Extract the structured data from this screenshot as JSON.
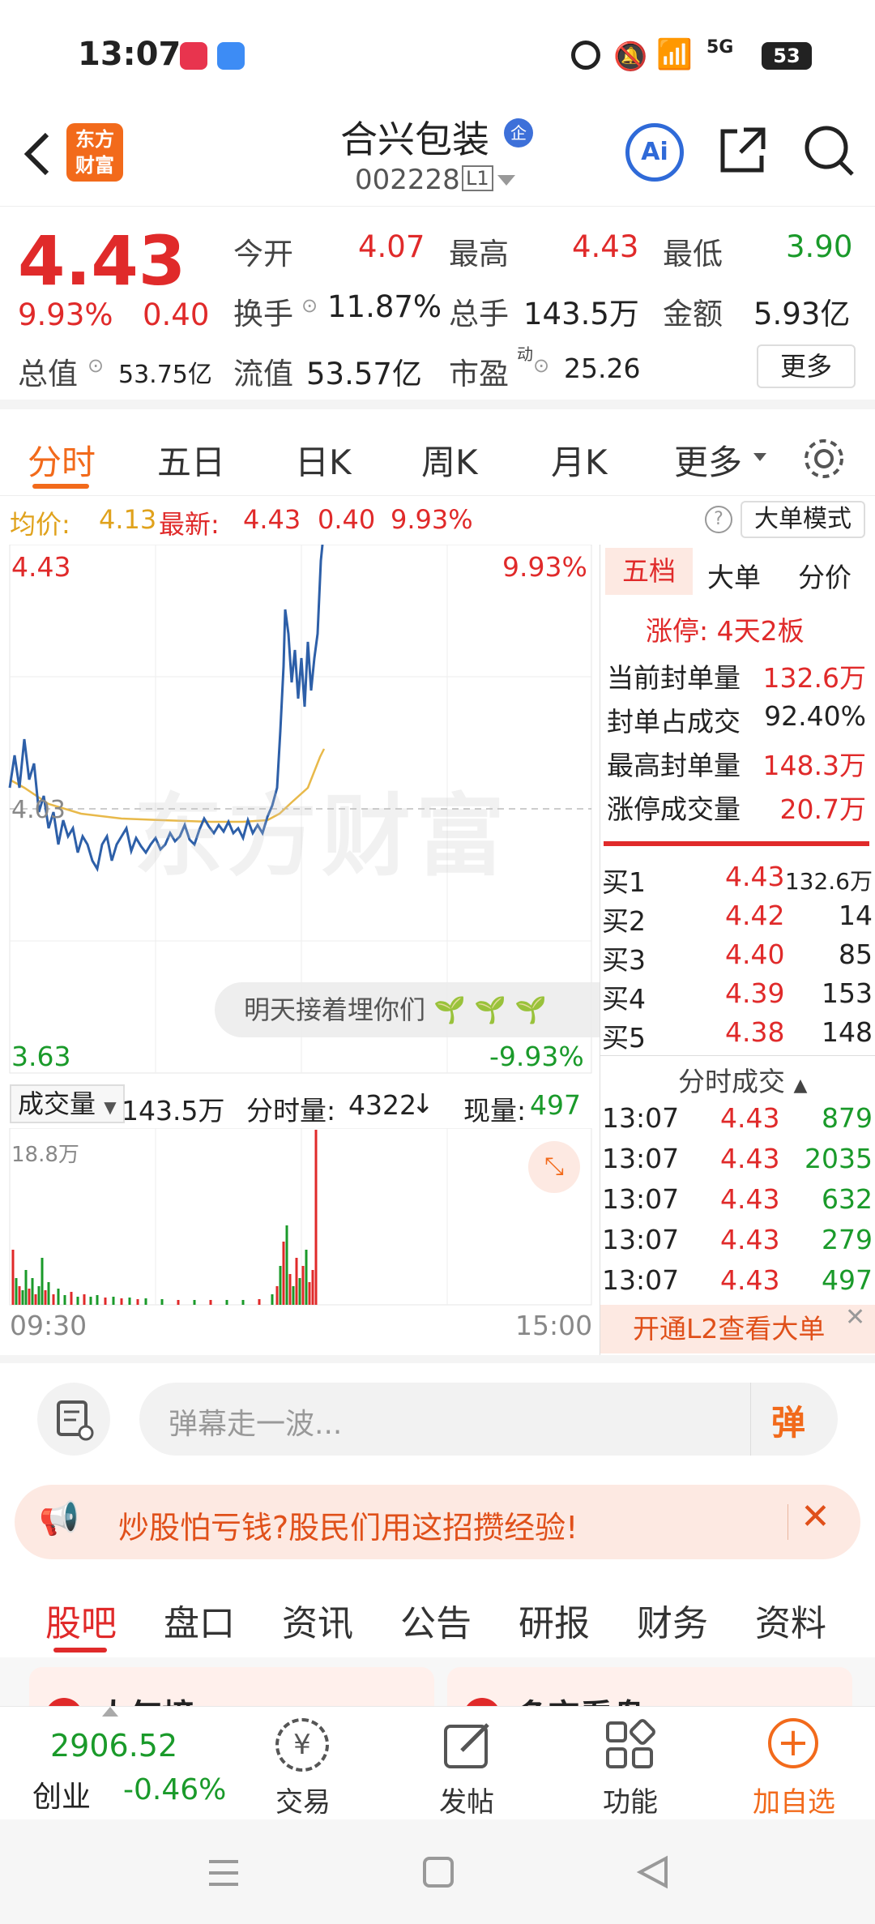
{
  "status_bar": {
    "time": "13:07",
    "network": "5G",
    "battery": "53"
  },
  "header": {
    "stock_name": "合兴包装",
    "stock_code": "002228",
    "level": "L1",
    "logo_line1": "东方",
    "logo_line2": "财富",
    "ai_label": "Ai",
    "enterprise_badge": "企"
  },
  "quote": {
    "price": "4.43",
    "change_pct": "9.93%",
    "change": "0.40",
    "open_label": "今开",
    "open": "4.07",
    "high_label": "最高",
    "high": "4.43",
    "low_label": "最低",
    "low": "3.90",
    "turnover_label": "换手",
    "turnover": "11.87%",
    "volume_label": "总手",
    "volume": "143.5万",
    "amount_label": "金额",
    "amount": "5.93亿",
    "mcap_label": "总值",
    "mcap": "53.75亿",
    "float_label": "流值",
    "float_cap": "53.57亿",
    "pe_label": "市盈",
    "pe_sup": "动",
    "pe": "25.26",
    "more_button": "更多"
  },
  "tabs": [
    "分时",
    "五日",
    "日K",
    "周K",
    "月K",
    "更多"
  ],
  "avg_bar": {
    "avg_label": "均价:",
    "avg": "4.13",
    "latest_label": "最新:",
    "latest": "4.43",
    "chg": "0.40",
    "pct": "9.93%",
    "mode_button": "大单模式"
  },
  "chart": {
    "top_price": "4.43",
    "top_pct": "9.93%",
    "mid_price": "4.03",
    "bottom_price": "3.63",
    "bottom_pct": "-9.93%",
    "watermark": "东方财富",
    "danmu": "明天接着埋你们",
    "time_start": "09:30",
    "time_end": "15:00"
  },
  "volume_bar": {
    "label": "成交量",
    "total": "143.5万",
    "tick_label": "分时量:",
    "tick": "4322",
    "now_label": "现量:",
    "now": "497",
    "max": "18.8万"
  },
  "side_tabs": [
    "五档",
    "大单",
    "分价"
  ],
  "limit": {
    "title": "涨停: 4天2板",
    "rows": [
      {
        "k": "当前封单量",
        "v": "132.6万"
      },
      {
        "k": "封单占成交",
        "v": "92.40%"
      },
      {
        "k": "最高封单量",
        "v": "148.3万"
      },
      {
        "k": "涨停成交量",
        "v": "20.7万"
      }
    ]
  },
  "bids": [
    {
      "k": "买1",
      "p": "4.43",
      "v": "132.6万"
    },
    {
      "k": "买2",
      "p": "4.42",
      "v": "14"
    },
    {
      "k": "买3",
      "p": "4.40",
      "v": "85"
    },
    {
      "k": "买4",
      "p": "4.39",
      "v": "153"
    },
    {
      "k": "买5",
      "p": "4.38",
      "v": "148"
    }
  ],
  "ticks_title": "分时成交",
  "ticks": [
    {
      "t": "13:07",
      "p": "4.43",
      "v": "879"
    },
    {
      "t": "13:07",
      "p": "4.43",
      "v": "2035"
    },
    {
      "t": "13:07",
      "p": "4.43",
      "v": "632"
    },
    {
      "t": "13:07",
      "p": "4.43",
      "v": "279"
    },
    {
      "t": "13:07",
      "p": "4.43",
      "v": "497"
    }
  ],
  "l2_banner": "开通L2查看大单",
  "comment": {
    "placeholder": "弹幕走一波...",
    "send": "弹"
  },
  "promo": {
    "text": "炒股怕亏钱?股民们用这招攒经验!"
  },
  "subtabs": [
    "股吧",
    "盘口",
    "资讯",
    "公告",
    "研报",
    "财务",
    "资料"
  ],
  "cards": [
    "人气榜",
    "多空看盘"
  ],
  "bottom": {
    "index_value": "2906.52",
    "index_name": "创业",
    "index_pct": "-0.46%",
    "items": [
      "交易",
      "发帖",
      "功能",
      "加自选"
    ]
  },
  "colors": {
    "up": "#e02a2a",
    "down": "#1a9a2a",
    "accent": "#f26a1b"
  }
}
